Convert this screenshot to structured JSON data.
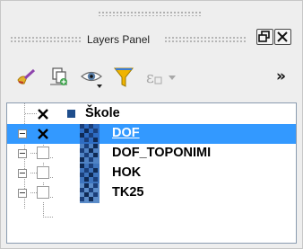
{
  "panel": {
    "title": "Layers Panel",
    "float_button_icon": "float-icon",
    "close_button_icon": "close-icon"
  },
  "toolbar": {
    "items": [
      {
        "icon": "styling-brush-icon"
      },
      {
        "icon": "add-group-icon"
      },
      {
        "icon": "visibility-eye-icon"
      },
      {
        "icon": "filter-funnel-icon"
      },
      {
        "icon": "expression-filter-icon"
      },
      {
        "icon": "more-chevron-icon",
        "label": "»"
      }
    ]
  },
  "layers": [
    {
      "name": "Škole",
      "checked": true,
      "selected": false,
      "type": "point"
    },
    {
      "name": "DOF",
      "checked": true,
      "selected": true,
      "type": "raster"
    },
    {
      "name": "DOF_TOPONIMI",
      "checked": false,
      "selected": false,
      "type": "raster"
    },
    {
      "name": "HOK",
      "checked": false,
      "selected": false,
      "type": "raster"
    },
    {
      "name": "TK25",
      "checked": false,
      "selected": false,
      "type": "raster"
    }
  ],
  "colors": {
    "selection": "#3399ff",
    "point_symbol": "#1f4e8c",
    "filter": "#f0b400"
  }
}
